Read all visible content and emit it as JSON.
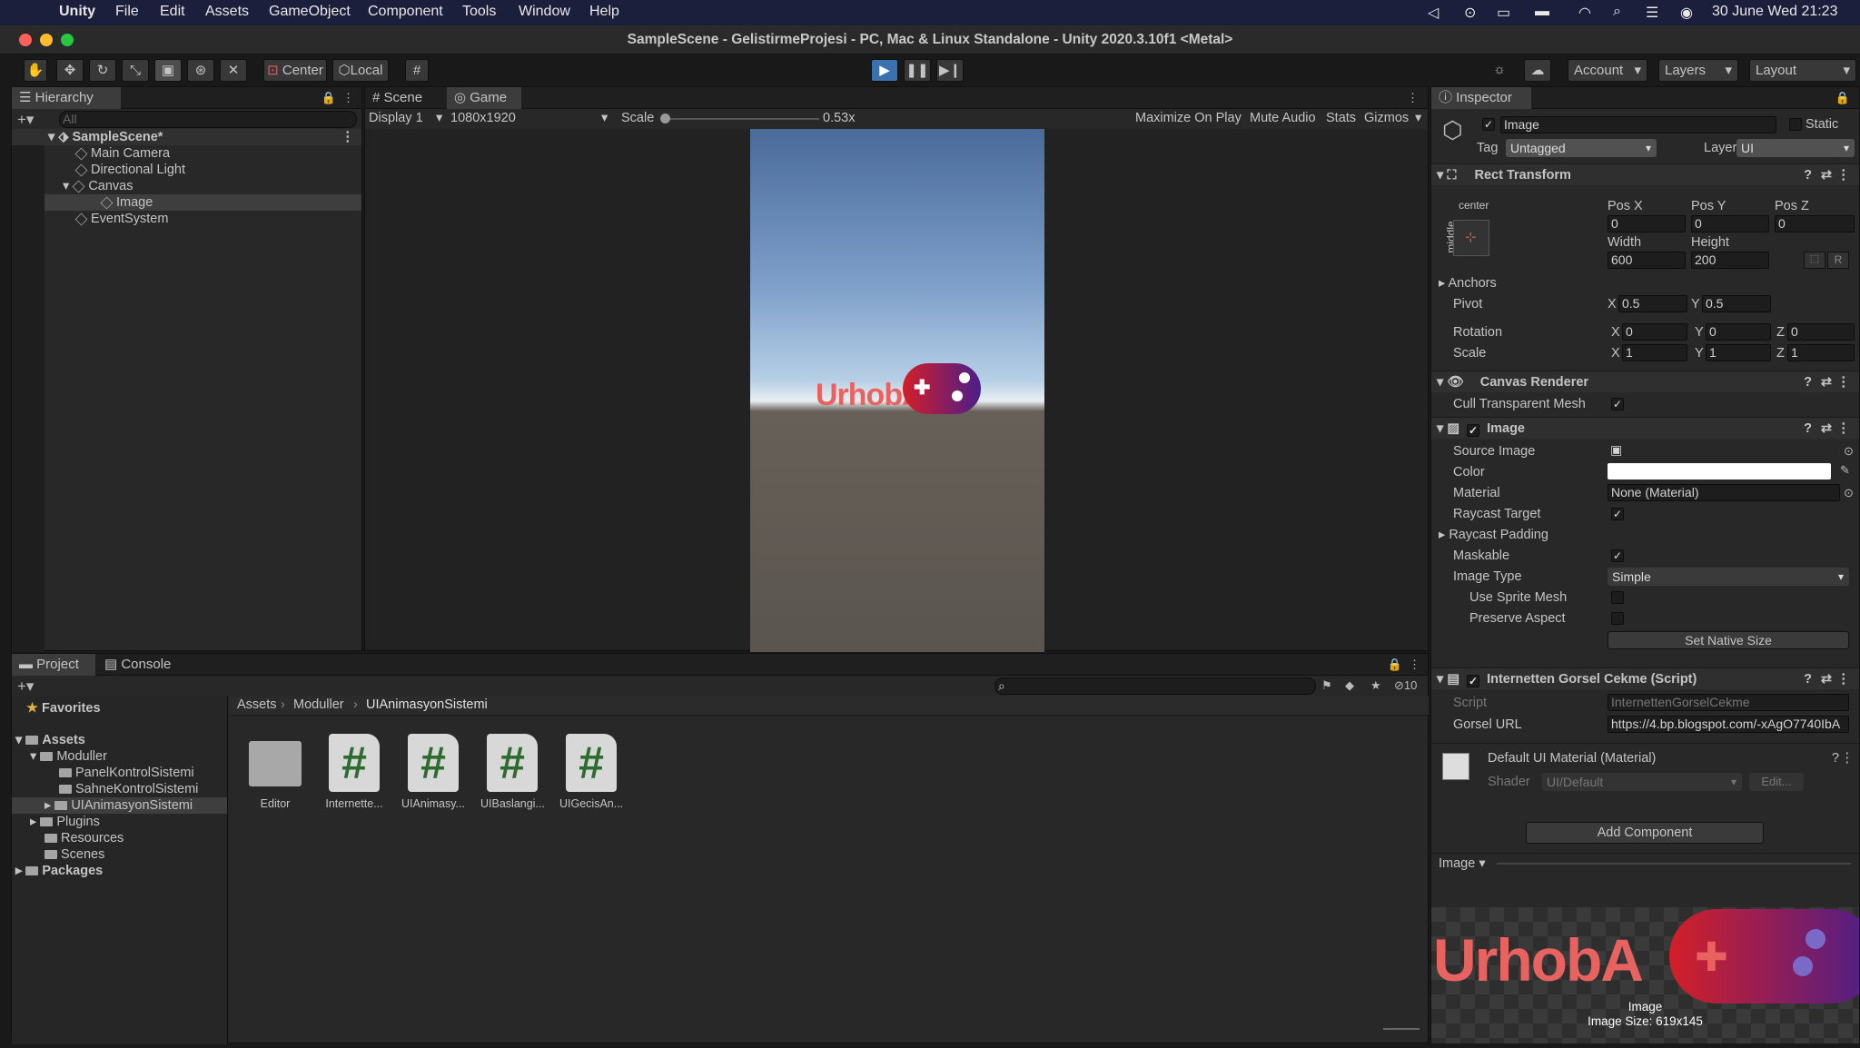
{
  "menubar": {
    "items": [
      "Unity",
      "File",
      "Edit",
      "Assets",
      "GameObject",
      "Component",
      "Tools",
      "Window",
      "Help"
    ],
    "datetime": "30 June Wed  21:23"
  },
  "window": {
    "title": "SampleScene - GelistirmeProjesi - PC, Mac & Linux Standalone - Unity 2020.3.10f1 <Metal>"
  },
  "toolbar": {
    "pivot": "Center",
    "space": "Local",
    "account": "Account",
    "layers": "Layers",
    "layout": "Layout"
  },
  "hierarchy": {
    "tab": "Hierarchy",
    "search_placeholder": "All",
    "scene": "SampleScene*",
    "items": [
      "Main Camera",
      "Directional Light",
      "Canvas",
      "Image",
      "EventSystem"
    ]
  },
  "game": {
    "tabs": [
      "Scene",
      "Game"
    ],
    "display": "Display 1",
    "resolution": "1080x1920",
    "scale_label": "Scale",
    "scale_value": "0.53x",
    "options": [
      "Maximize On Play",
      "Mute Audio",
      "Stats",
      "Gizmos"
    ],
    "logo_text": "UrhobA"
  },
  "project": {
    "tabs": [
      "Project",
      "Console"
    ],
    "favorites": "Favorites",
    "tree": [
      "Assets",
      "Moduller",
      "PanelKontrolSistemi",
      "SahneKontrolSistemi",
      "UIAnimasyonSistemi",
      "Plugins",
      "Resources",
      "Scenes",
      "Packages"
    ],
    "breadcrumb": [
      "Assets",
      "Moduller",
      "UIAnimasyonSistemi"
    ],
    "hidden_count": "10",
    "assets": [
      "Editor",
      "Internette...",
      "UIAnimasy...",
      "UIBaslangi...",
      "UIGecisAn..."
    ]
  },
  "inspector": {
    "tab": "Inspector",
    "object_name": "Image",
    "static_label": "Static",
    "tag_label": "Tag",
    "tag_value": "Untagged",
    "layer_label": "Layer",
    "layer_value": "UI",
    "rect": {
      "title": "Rect Transform",
      "anchor_h": "center",
      "anchor_v": "middle",
      "posx_label": "Pos X",
      "posy_label": "Pos Y",
      "posz_label": "Pos Z",
      "posx": "0",
      "posy": "0",
      "posz": "0",
      "width_label": "Width",
      "height_label": "Height",
      "width": "600",
      "height": "200",
      "anchors": "Anchors",
      "pivot": "Pivot",
      "pivot_x": "0.5",
      "pivot_y": "0.5",
      "rotation": "Rotation",
      "rot_x": "0",
      "rot_y": "0",
      "rot_z": "0",
      "scale": "Scale",
      "sc_x": "1",
      "sc_y": "1",
      "sc_z": "1",
      "r_btn": "R",
      "x": "X",
      "y": "Y",
      "z": "Z"
    },
    "canvas_renderer": {
      "title": "Canvas Renderer",
      "cull": "Cull Transparent Mesh"
    },
    "image": {
      "title": "Image",
      "source": "Source Image",
      "color": "Color",
      "material": "Material",
      "material_value": "None (Material)",
      "raycast": "Raycast Target",
      "raycast_padding": "Raycast Padding",
      "maskable": "Maskable",
      "image_type": "Image Type",
      "image_type_value": "Simple",
      "sprite_mesh": "Use Sprite Mesh",
      "preserve": "Preserve Aspect",
      "native": "Set Native Size"
    },
    "script": {
      "title": "Internetten Gorsel Cekme (Script)",
      "script_label": "Script",
      "script_value": "InternettenGorselCekme",
      "url_label": "Gorsel URL",
      "url_value": "https://4.bp.blogspot.com/-xAgO7740IbA"
    },
    "material": {
      "title": "Default UI Material (Material)",
      "shader_label": "Shader",
      "shader_value": "UI/Default",
      "edit": "Edit..."
    },
    "add_component": "Add Component",
    "preview": {
      "dropdown": "Image",
      "logo_text": "UrhobA",
      "name": "Image",
      "size": "Image Size: 619x145"
    }
  },
  "colors": {
    "menubar": "#1b1f3b",
    "panel": "#282828",
    "accent": "#3a72b0",
    "logo": "#e8625f"
  }
}
